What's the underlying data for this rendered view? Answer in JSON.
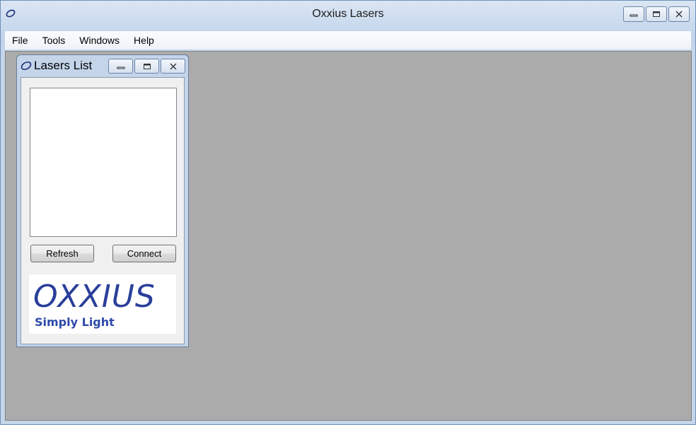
{
  "window": {
    "title": "Oxxius Lasers"
  },
  "menu": {
    "items": [
      "File",
      "Tools",
      "Windows",
      "Help"
    ]
  },
  "child_window": {
    "title": "Lasers List",
    "refresh_label": "Refresh",
    "connect_label": "Connect",
    "logo_text": "OXXIUS",
    "logo_tagline": "Simply Light"
  },
  "colors": {
    "mdi_background": "#ababab",
    "logo_blue": "#2a3f9a"
  }
}
